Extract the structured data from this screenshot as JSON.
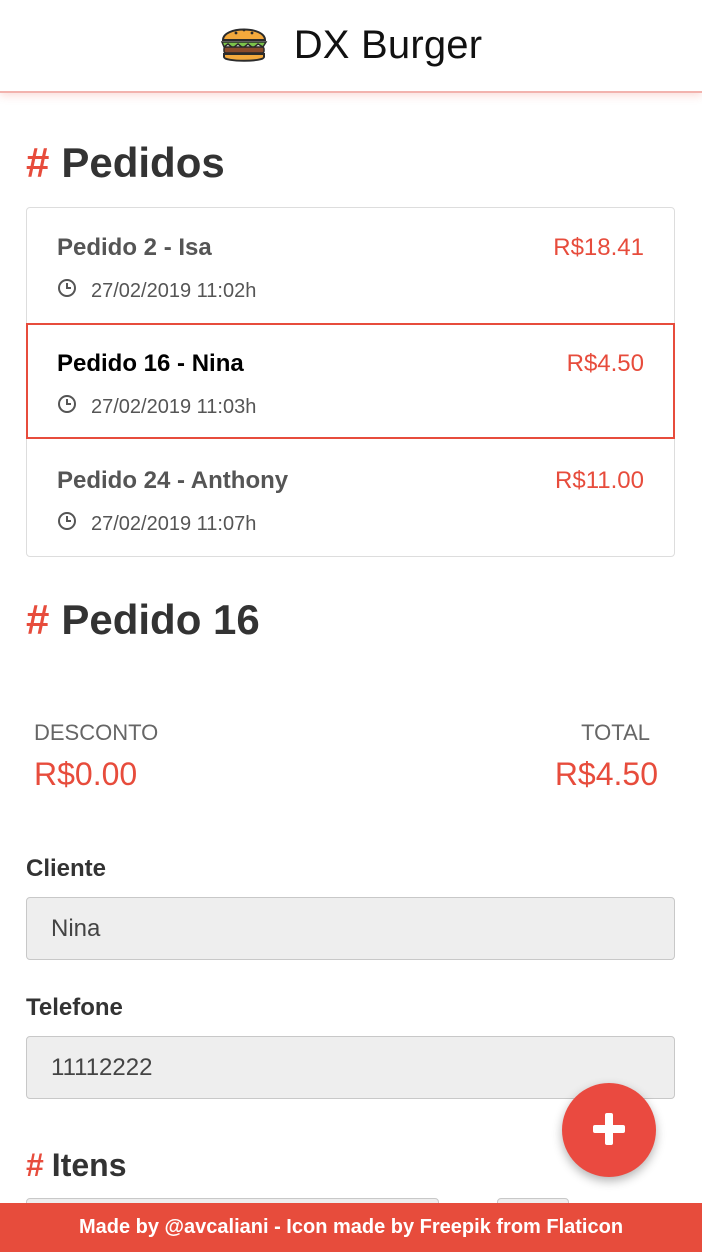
{
  "app": {
    "title": "DX Burger",
    "logo_icon": "burger-icon"
  },
  "orders_section": {
    "hash": "#",
    "title": "Pedidos",
    "orders": [
      {
        "name": "Pedido 2 - Isa",
        "price": "R$18.41",
        "time": "27/02/2019 11:02h",
        "selected": false
      },
      {
        "name": "Pedido 16 - Nina",
        "price": "R$4.50",
        "time": "27/02/2019 11:03h",
        "selected": true
      },
      {
        "name": "Pedido 24 - Anthony",
        "price": "R$11.00",
        "time": "27/02/2019 11:07h",
        "selected": false
      }
    ],
    "time_icon": "clock-icon"
  },
  "order_detail": {
    "hash": "#",
    "title": "Pedido 16",
    "discount_label": "DESCONTO",
    "discount_value": "R$0.00",
    "total_label": "TOTAL",
    "total_value": "R$4.50",
    "client_label": "Cliente",
    "client_value": "Nina",
    "phone_label": "Telefone",
    "phone_value": "11112222"
  },
  "items_section": {
    "hash": "#",
    "title": "Itens"
  },
  "fab": {
    "icon": "plus-icon"
  },
  "footer": {
    "text": "Made by @avcaliani - Icon made by Freepik from Flaticon"
  },
  "colors": {
    "accent": "#e74c3c",
    "input_bg": "#eeeeee",
    "text": "#333333"
  }
}
